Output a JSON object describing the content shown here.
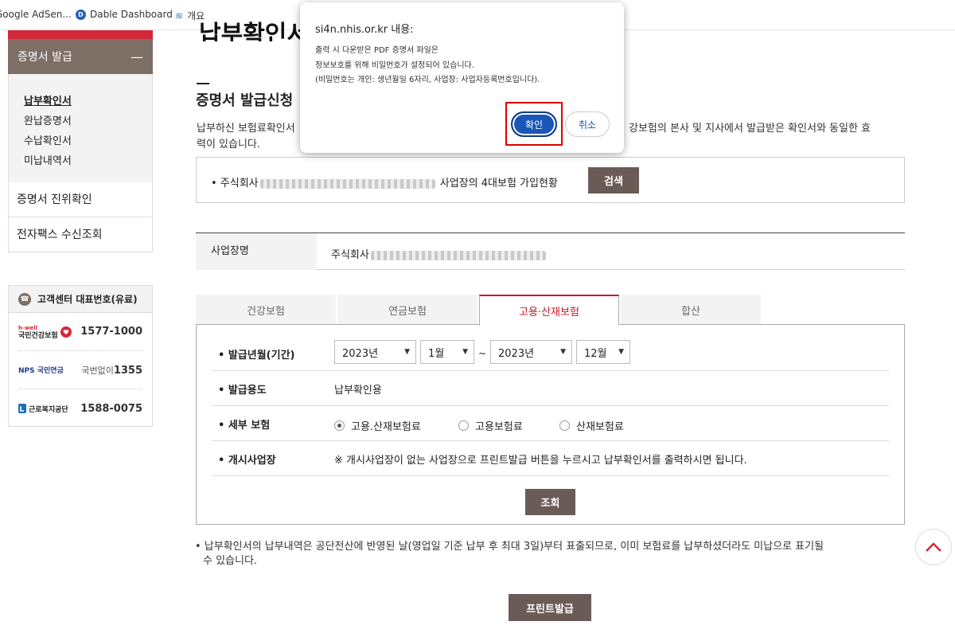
{
  "bookmarks": [
    {
      "label": "Google AdSen..."
    },
    {
      "label": "Dable Dashboard",
      "icon_letter": "D"
    },
    {
      "label": "개요"
    }
  ],
  "sidebar": {
    "section_title": "증명서 발급",
    "collapse_symbol": "—",
    "sub_items": [
      "납부확인서",
      "완납증명서",
      "수납확인서",
      "미납내역서"
    ],
    "items": [
      "증명서 진위확인",
      "전자팩스 수신조회"
    ]
  },
  "customer_center": {
    "title": "고객센터 대표번호(유료)",
    "rows": [
      {
        "logo": "국민건강보험",
        "logo_sub": "h-well",
        "number": "1577-1000"
      },
      {
        "logo": "NPS 국민연금",
        "prefix": "국번없이",
        "number": "1355"
      },
      {
        "logo": "근로복지공단",
        "number": "1588-0075"
      }
    ]
  },
  "main": {
    "page_title": "납부확인서",
    "section_title": "증명서 발급신청",
    "desc_line1": "납부하신 보험료확인서",
    "desc_line1_tail": "강보험의 본사 및 지사에서 발급받은 확인서와 동일한 효",
    "desc_line2": "력이 있습니다.",
    "company_prefix": "• 주식회사",
    "company_suffix": "사업장의 4대보험 가입현황",
    "search_label": "검색",
    "business_label": "사업장명",
    "business_value": "주식회사",
    "tabs": [
      "건강보험",
      "연금보험",
      "고용·산재보험",
      "합산"
    ],
    "form": {
      "period_label": "발급년월(기간)",
      "from_year": "2023년",
      "from_month": "1월",
      "tilde": "~",
      "to_year": "2023년",
      "to_month": "12월",
      "purpose_label": "발급용도",
      "purpose_value": "납부확인용",
      "detail_label": "세부 보험",
      "detail_options": [
        "고용.산재보험료",
        "고용보험료",
        "산재보험료"
      ],
      "start_label": "개시사업장",
      "start_note": "※ 개시사업장이 없는 사업장으로 프린트발급 버튼을 누르시고 납부확인서를 출력하시면 됩니다.",
      "query_label": "조회"
    },
    "note_line1": "• 납부확인서의 납부내역은 공단전산에 반영된 날(영업일 기준 납부 후 최대 3일)부터 표출되므로, 이미 보험료를 납부하셨더라도 미납으로 표기될",
    "note_line2": "수 있습니다.",
    "print_label": "프린트발급"
  },
  "dialog": {
    "title": "si4n.nhis.or.kr 내용:",
    "line1": "출력 시 다운받은 PDF 증명서 파일은",
    "line2": "정보보호를 위해 비밀번호가 설정되어 있습니다.",
    "line3": "(비밀번호는 개인: 생년월일 6자리, 사업장: 사업자등록번호입니다).",
    "ok_label": "확인",
    "cancel_label": "취소"
  },
  "colors": {
    "accent_red": "#d2283a",
    "sidebar_brown": "#7d6e66",
    "button_dark": "#6b5b57",
    "dialog_blue": "#1a56b8"
  }
}
